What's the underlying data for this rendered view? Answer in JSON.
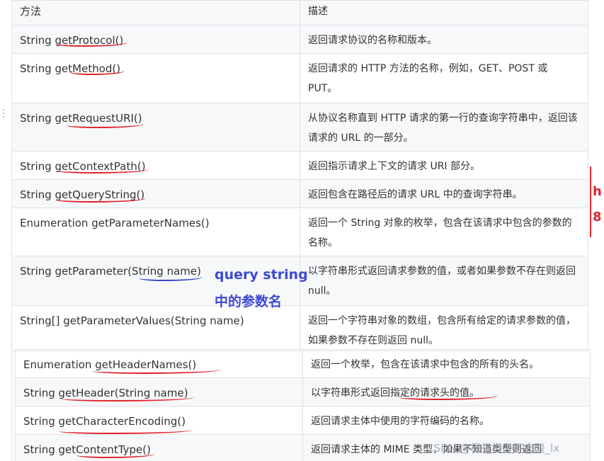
{
  "header": {
    "method": "方法",
    "description": "描述"
  },
  "rows": [
    {
      "method": "String getProtocol()",
      "description": "返回请求协议的名称和版本。"
    },
    {
      "method": "String getMethod()",
      "description": "返回请求的 HTTP 方法的名称，例如，GET、POST 或 PUT。"
    },
    {
      "method": "String getRequestURI()",
      "description": "从协议名称直到 HTTP 请求的第一行的查询字符串中，返回该请求的 URL 的一部分。"
    },
    {
      "method": "String getContextPath()",
      "description": "返回指示请求上下文的请求 URI 部分。"
    },
    {
      "method": "String getQueryString()",
      "description": "返回包含在路径后的请求 URL 中的查询字符串。"
    },
    {
      "method": "Enumeration getParameterNames()",
      "description": "返回一个 String 对象的枚举，包含在该请求中包含的参数的名称。"
    },
    {
      "method": "String getParameter(String name)",
      "description": "以字符串形式返回请求参数的值，或者如果参数不存在则返回 null。"
    },
    {
      "method": "String[] getParameterValues(String name)",
      "description": "返回一个字符串对象的数组，包含所有给定的请求参数的值，如果参数不存在则返回 null。"
    }
  ],
  "rows_lower": [
    {
      "method": "Enumeration getHeaderNames()",
      "description": "返回一个枚举，包含在该请求中包含的所有的头名。"
    },
    {
      "method": "String getHeader(String name)",
      "description": "以字符串形式返回指定的请求头的值。"
    },
    {
      "method": "String getCharacterEncoding()",
      "description": "返回请求主体中使用的字符编码的名称。"
    },
    {
      "method": "String getContentType()",
      "description": "返回请求主体的 MIME 类型，如果不知道类型则返回"
    }
  ],
  "annotation": {
    "line1": "query string",
    "line2": "中的参数名"
  },
  "edge_marks": {
    "top": "h",
    "bottom": "8"
  },
  "watermark": "CSDN @橙子橙子不太酸_lx",
  "colors": {
    "annotation": "#3d49d3",
    "underline": "#e0242b",
    "border": "#dfe2e5",
    "stripe": "#f6f8fa"
  }
}
